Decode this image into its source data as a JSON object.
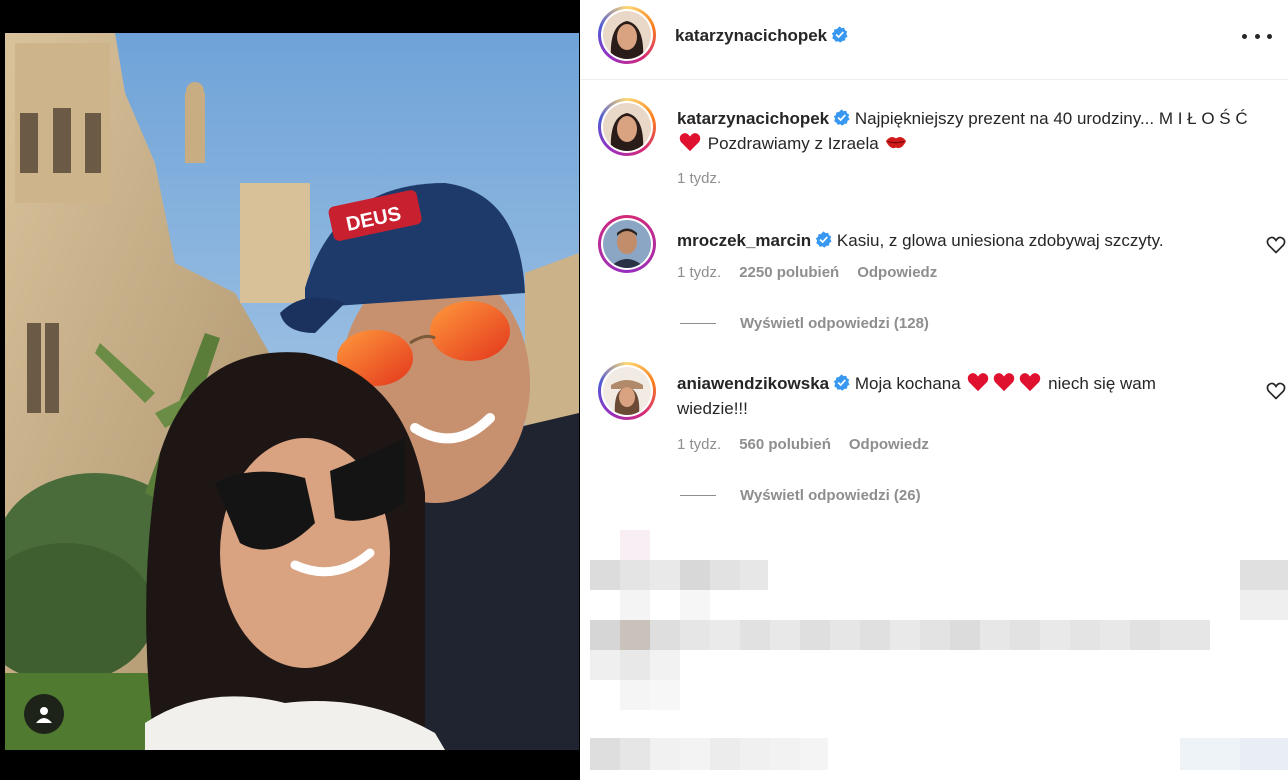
{
  "post": {
    "author": "katarzynacichopek",
    "more_icon": "more-horizontal-icon"
  },
  "caption": {
    "username": "katarzynacichopek",
    "text": "Najpiękniejszy prezent na 40 urodziny... M I Ł O Ś Ć",
    "text_after": "Pozdrawiamy z Izraela",
    "time": "1 tydz."
  },
  "comments": [
    {
      "username": "mroczek_marcin",
      "text": "Kasiu, z glowa uniesiona zdobywaj szczyty.",
      "time": "1 tydz.",
      "likes": "2250 polubień",
      "reply_label": "Odpowiedz",
      "view_replies": "Wyświetl odpowiedzi (128)"
    },
    {
      "username": "aniawendzikowska",
      "text_before": "Moja kochana",
      "text_after": "niech się wam",
      "text_line2": "wiedzie!!!",
      "time": "1 tydz.",
      "likes": "560 polubień",
      "reply_label": "Odpowiedz",
      "view_replies": "Wyświetl odpowiedzi (26)"
    }
  ],
  "colors": {
    "verified": "#3897f0",
    "heart": "#e0102f",
    "muted_text": "#8e8e8e"
  }
}
